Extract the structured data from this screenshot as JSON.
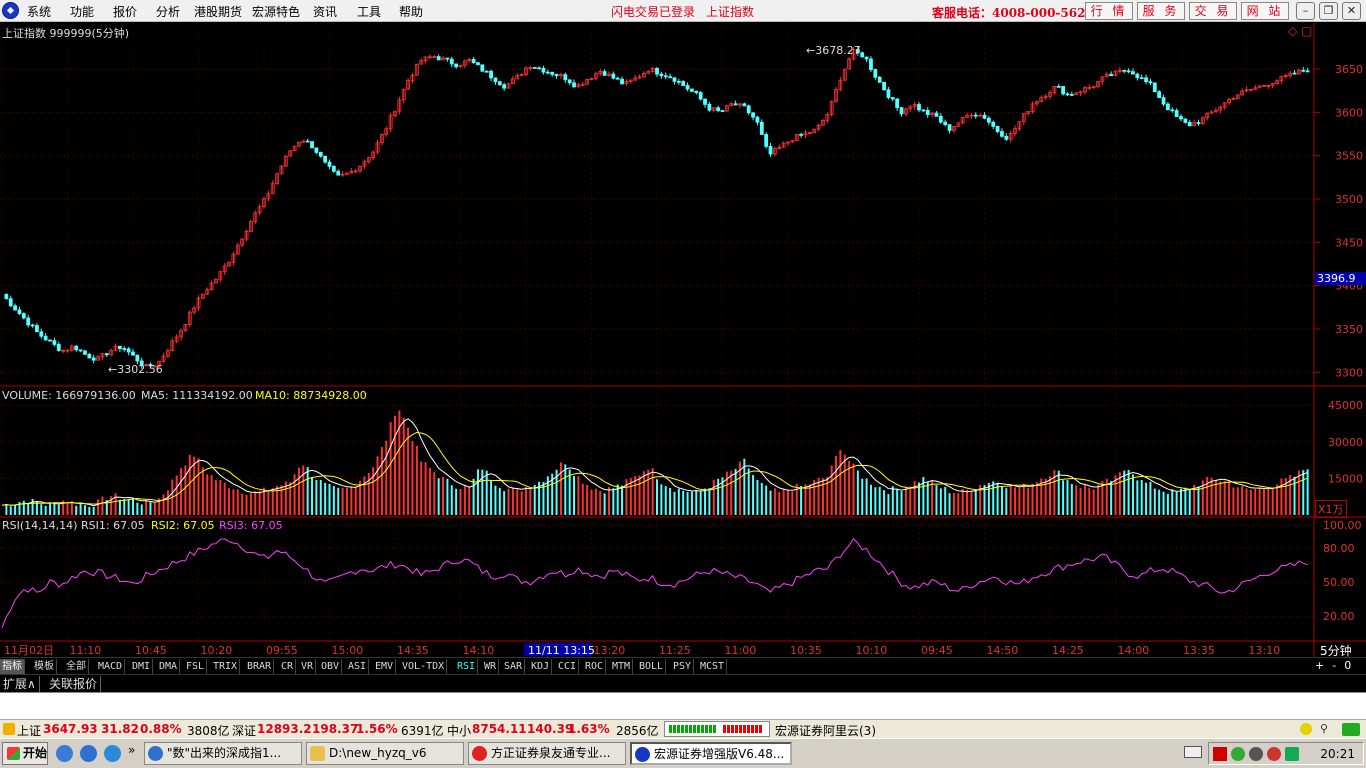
{
  "menu": {
    "items": [
      "系统",
      "功能",
      "报价",
      "分析",
      "港股期货",
      "宏源特色",
      "资讯",
      "工具",
      "帮助"
    ],
    "status_text": "闪电交易已登录",
    "index_link": "上证指数",
    "hotline": "客服电话：4008-000-562",
    "service_buttons": [
      "行 情",
      "服 务",
      "交 易",
      "网 站"
    ],
    "window_buttons": [
      "–",
      "❐",
      "✕"
    ]
  },
  "chart_data": {
    "type": "candlestick",
    "title": "上证指数 999999(5分钟)",
    "price_axis_ticks": [
      3650,
      3600,
      3550,
      3500,
      3450,
      3400,
      3350,
      3300
    ],
    "price_range": [
      3290,
      3680
    ],
    "current_price_label": "3396.9",
    "high_marker": "3678.27",
    "low_marker": "3302.56",
    "price_path": [
      3390,
      3375,
      3360,
      3345,
      3335,
      3325,
      3330,
      3320,
      3315,
      3325,
      3330,
      3318,
      3306,
      3310,
      3330,
      3350,
      3375,
      3395,
      3410,
      3430,
      3455,
      3480,
      3500,
      3530,
      3555,
      3570,
      3560,
      3540,
      3525,
      3530,
      3540,
      3555,
      3580,
      3610,
      3640,
      3660,
      3665,
      3660,
      3655,
      3660,
      3650,
      3640,
      3630,
      3640,
      3655,
      3650,
      3645,
      3640,
      3630,
      3640,
      3648,
      3640,
      3632,
      3640,
      3650,
      3645,
      3640,
      3630,
      3620,
      3605,
      3600,
      3610,
      3605,
      3590,
      3550,
      3560,
      3570,
      3575,
      3580,
      3600,
      3640,
      3670,
      3665,
      3640,
      3620,
      3600,
      3610,
      3600,
      3595,
      3580,
      3590,
      3600,
      3595,
      3580,
      3570,
      3590,
      3610,
      3620,
      3630,
      3620,
      3625,
      3630,
      3640,
      3645,
      3650,
      3640,
      3630,
      3610,
      3595,
      3585,
      3590,
      3600,
      3610,
      3620,
      3625,
      3630,
      3635,
      3640,
      3645,
      3650
    ],
    "volume_header": {
      "label": "VOLUME: 166979136.00",
      "ma5": "MA5: 111334192.00",
      "ma10": "MA10: 88734928.00"
    },
    "volume_axis_ticks": [
      45000,
      30000,
      15000
    ],
    "volume_unit": "X1万",
    "volume_path": [
      4,
      5,
      6,
      5,
      4,
      6,
      5,
      4,
      5,
      8,
      7,
      6,
      5,
      6,
      12,
      20,
      25,
      18,
      14,
      12,
      10,
      9,
      10,
      12,
      13,
      22,
      16,
      12,
      10,
      11,
      15,
      20,
      30,
      45,
      35,
      22,
      18,
      14,
      12,
      11,
      20,
      14,
      11,
      10,
      12,
      14,
      18,
      22,
      16,
      12,
      10,
      11,
      13,
      16,
      20,
      14,
      11,
      10,
      9,
      12,
      15,
      18,
      22,
      14,
      10,
      9,
      11,
      12,
      14,
      16,
      28,
      20,
      15,
      12,
      10,
      11,
      13,
      15,
      12,
      10,
      9,
      11,
      13,
      14,
      12,
      11,
      13,
      16,
      18,
      14,
      12,
      11,
      13,
      15,
      20,
      14,
      12,
      10,
      9,
      11,
      13,
      15,
      14,
      12,
      10,
      11,
      12,
      14,
      16,
      20
    ],
    "rsi_header": {
      "label": "RSI(14,14,14)",
      "rsi1": "RSI1: 67.05",
      "rsi2": "RSI2: 67.05",
      "rsi3": "RSI3: 67.05"
    },
    "rsi_axis_ticks": [
      "100.00",
      "80.00",
      "50.00",
      "20.00"
    ],
    "rsi_path": [
      10,
      35,
      45,
      40,
      50,
      48,
      55,
      60,
      58,
      55,
      52,
      48,
      55,
      60,
      65,
      70,
      75,
      80,
      85,
      88,
      82,
      75,
      70,
      78,
      72,
      65,
      55,
      48,
      52,
      58,
      62,
      60,
      64,
      66,
      62,
      56,
      60,
      65,
      70,
      68,
      60,
      55,
      58,
      52,
      50,
      55,
      60,
      57,
      62,
      58,
      55,
      60,
      56,
      52,
      54,
      50,
      48,
      52,
      56,
      60,
      58,
      55,
      52,
      48,
      40,
      45,
      50,
      55,
      60,
      62,
      75,
      85,
      80,
      70,
      60,
      50,
      45,
      48,
      50,
      45,
      42,
      48,
      52,
      55,
      50,
      48,
      54,
      58,
      62,
      65,
      68,
      70,
      72,
      65,
      58,
      55,
      60,
      62,
      58,
      52,
      48,
      45,
      40,
      45,
      50,
      55,
      60,
      62,
      65,
      68
    ],
    "time_labels": [
      "11月02日",
      "11:10",
      "10:45",
      "10:20",
      "09:55",
      "15:00",
      "14:35",
      "14:10",
      "11/11 13:15",
      "13:20",
      "11:25",
      "11:00",
      "10:35",
      "10:10",
      "09:45",
      "14:50",
      "14:25",
      "14:00",
      "13:35",
      "13:10"
    ],
    "period_label": "5分钟"
  },
  "indicator_tabs": [
    "指标",
    "模板",
    "全部",
    "MACD",
    "DMI",
    "DMA",
    "FSL",
    "TRIX",
    "BRAR",
    "CR",
    "VR",
    "OBV",
    "ASI",
    "EMV",
    "VOL-TDX",
    "RSI",
    "WR",
    "SAR",
    "KDJ",
    "CCI",
    "ROC",
    "MTM",
    "BOLL",
    "PSY",
    "MCST"
  ],
  "indicator_tab_active": "RSI",
  "extension_tabs": [
    "扩展∧",
    "关联报价"
  ],
  "zoom_buttons": [
    "+",
    "-",
    "0"
  ],
  "statusbar": {
    "sh_name": "上证",
    "sh_value": "3647.93",
    "sh_change": "31.82",
    "sh_pct": "0.88%",
    "sh_amount": "3808亿",
    "sz_name": "深证",
    "sz_value": "12893.2",
    "sz_change": "198.37",
    "sz_pct": "1.56%",
    "sz_amount": "6391亿",
    "zx_name": "中小",
    "zx_value": "8754.11",
    "zx_change": "140.39",
    "zx_pct": "1.63%",
    "zx_amount": "2856亿",
    "server": "宏源证券阿里云(3)"
  },
  "taskbar": {
    "start": "开始",
    "tasks": [
      "\"数\"出来的深成指1...",
      "D:\\new_hyzq_v6",
      "方正证券泉友通专业...",
      "宏源证券增强版V6.48..."
    ],
    "active_task": 3,
    "clock": "20:21"
  },
  "colors": {
    "up": "#ff3232",
    "down": "#54ffff",
    "axis": "#b00000",
    "rsi": "#ff40ff",
    "ma5": "#ffffff",
    "ma10": "#ffff00"
  }
}
